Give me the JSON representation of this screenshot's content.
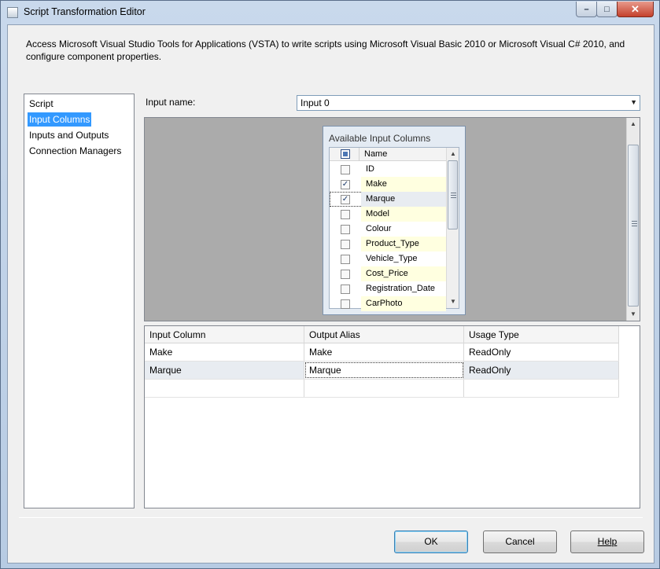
{
  "window": {
    "title": "Script Transformation Editor",
    "minimize_glyph": "–",
    "maximize_glyph": "□",
    "close_glyph": "✕"
  },
  "description": "Access Microsoft Visual Studio Tools for Applications (VSTA) to write scripts using Microsoft Visual Basic 2010 or Microsoft Visual C# 2010, and configure component properties.",
  "nav": {
    "items": [
      "Script",
      "Input Columns",
      "Inputs and Outputs",
      "Connection Managers"
    ],
    "selected": "Input Columns"
  },
  "input_name": {
    "label": "Input name:",
    "value": "Input 0",
    "arrow_glyph": "▼"
  },
  "available_columns": {
    "title": "Available Input Columns",
    "header": "Name",
    "columns": [
      {
        "name": "ID",
        "checked": false
      },
      {
        "name": "Make",
        "checked": true
      },
      {
        "name": "Marque",
        "checked": true
      },
      {
        "name": "Model",
        "checked": false
      },
      {
        "name": "Colour",
        "checked": false
      },
      {
        "name": "Product_Type",
        "checked": false
      },
      {
        "name": "Vehicle_Type",
        "checked": false
      },
      {
        "name": "Cost_Price",
        "checked": false
      },
      {
        "name": "Registration_Date",
        "checked": false
      },
      {
        "name": "CarPhoto",
        "checked": false
      }
    ],
    "check_glyph": "✓",
    "scroll_up_glyph": "▲",
    "scroll_down_glyph": "▼"
  },
  "grid": {
    "headers": [
      "Input Column",
      "Output Alias",
      "Usage Type"
    ],
    "rows": [
      {
        "input": "Make",
        "alias": "Make",
        "usage": "ReadOnly"
      },
      {
        "input": "Marque",
        "alias": "Marque",
        "usage": "ReadOnly"
      }
    ]
  },
  "buttons": {
    "ok": "OK",
    "cancel": "Cancel",
    "help": "Help"
  },
  "colors": {
    "selection": "#3399ff",
    "list_alt_row": "#ffffe0",
    "area_background": "#ababab"
  }
}
